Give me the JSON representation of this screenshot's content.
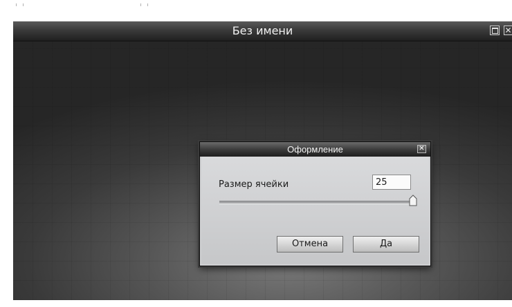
{
  "app": {
    "title": "Без имени",
    "close_glyph": "✕"
  },
  "dialog": {
    "title": "Оформление",
    "close_glyph": "✕",
    "cell_size_label": "Размер ячейки",
    "cell_size_value": "25",
    "slider_fraction": 1.0,
    "cancel_label": "Отмена",
    "ok_label": "Да"
  },
  "icons": {
    "maximize": "maximize-icon",
    "close": "close-icon",
    "slider_thumb": "slider-thumb-icon"
  },
  "colors": {
    "titlebar_dark": "#202020",
    "dialog_bg": "#cfd0d2",
    "canvas_center": "#7a7a7a"
  }
}
